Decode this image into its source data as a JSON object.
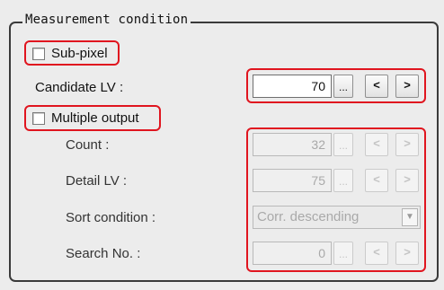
{
  "group": {
    "title": "Measurement condition"
  },
  "sub_pixel": {
    "label": "Sub-pixel",
    "checked": false
  },
  "candidate_lv": {
    "label": "Candidate LV :",
    "value": "70",
    "ellipsis": "...",
    "prev": "<",
    "next": ">"
  },
  "multiple_output": {
    "label": "Multiple output",
    "checked": false
  },
  "count": {
    "label": "Count :",
    "value": "32",
    "ellipsis": "...",
    "prev": "<",
    "next": ">"
  },
  "detail_lv": {
    "label": "Detail LV :",
    "value": "75",
    "ellipsis": "...",
    "prev": "<",
    "next": ">"
  },
  "sort_condition": {
    "label": "Sort condition :",
    "value": "Corr. descending",
    "arrow": "▼"
  },
  "search_no": {
    "label": "Search No. :",
    "value": "0",
    "ellipsis": "...",
    "prev": "<",
    "next": ">"
  },
  "colors": {
    "callout": "#e0151f",
    "panel": "#ececec",
    "frame": "#3a3a3a"
  }
}
